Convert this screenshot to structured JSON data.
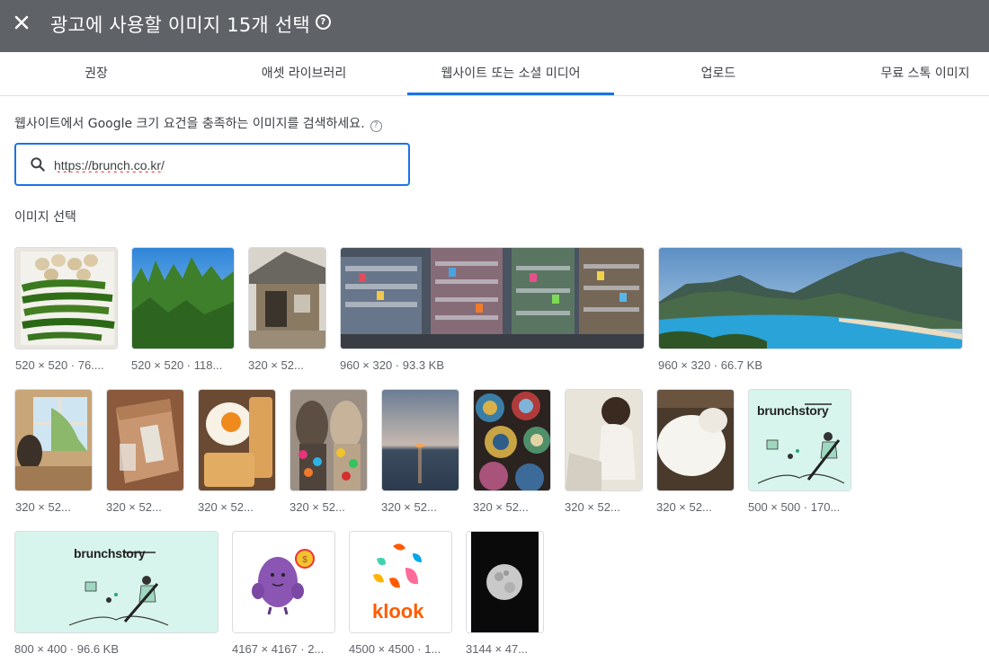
{
  "header": {
    "title": "광고에 사용할 이미지 15개 선택",
    "help_glyph": "?"
  },
  "tabs": [
    {
      "label": "권장"
    },
    {
      "label": "애셋 라이브러리"
    },
    {
      "label": "웹사이트 또는 소셜 미디어"
    },
    {
      "label": "업로드"
    },
    {
      "label": "무료 스톡 이미지"
    }
  ],
  "active_tab": "웹사이트 또는 소셜 미디어",
  "instruction": "웹사이트에서 Google 크기 요건을 충족하는 이미지를 검색하세요.",
  "search": {
    "value": "https://brunch.co.kr/",
    "icon": "search-icon"
  },
  "section_label": "이미지 선택",
  "images": [
    {
      "caption": "520 × 520 · 76....",
      "subject": "green peppers and garlic"
    },
    {
      "caption": "520 × 520 · 118...",
      "subject": "pine trees and blue sky"
    },
    {
      "caption": "320 × 52...",
      "subject": "wooden house"
    },
    {
      "caption": "960 × 320 · 93.3 KB",
      "subject": "crowded shop shelves"
    },
    {
      "caption": "960 × 320 · 66.7 KB",
      "subject": "coastal bay and mountains"
    },
    {
      "caption": "320 × 52...",
      "subject": "cat by window"
    },
    {
      "caption": "320 × 52...",
      "subject": "cardboard box"
    },
    {
      "caption": "320 × 52...",
      "subject": "fried egg and toast"
    },
    {
      "caption": "320 × 52...",
      "subject": "alpacas with tassels"
    },
    {
      "caption": "320 × 52...",
      "subject": "sunset over sea"
    },
    {
      "caption": "320 × 52...",
      "subject": "ceramic bowls"
    },
    {
      "caption": "320 × 52...",
      "subject": "child sitting"
    },
    {
      "caption": "320 × 52...",
      "subject": "white fluffy dog"
    },
    {
      "caption": "500 × 500 · 170...",
      "subject": "brunchstory logo",
      "logo_text": "brunchstory"
    },
    {
      "caption": "800 × 400 · 96.6 KB",
      "subject": "brunchstory banner",
      "logo_text": "brunchstory"
    },
    {
      "caption": "4167 × 4167 · 2...",
      "subject": "purple character"
    },
    {
      "caption": "4500 × 4500 · 1...",
      "subject": "klook logo",
      "logo_text": "klook"
    },
    {
      "caption": "3144 × 47...",
      "subject": "full moon"
    }
  ],
  "colors": {
    "header_bg": "#5f6368",
    "accent": "#1a73e8",
    "brunch_mint": "#d7f5ec",
    "klook_orange": "#ff5b00"
  }
}
